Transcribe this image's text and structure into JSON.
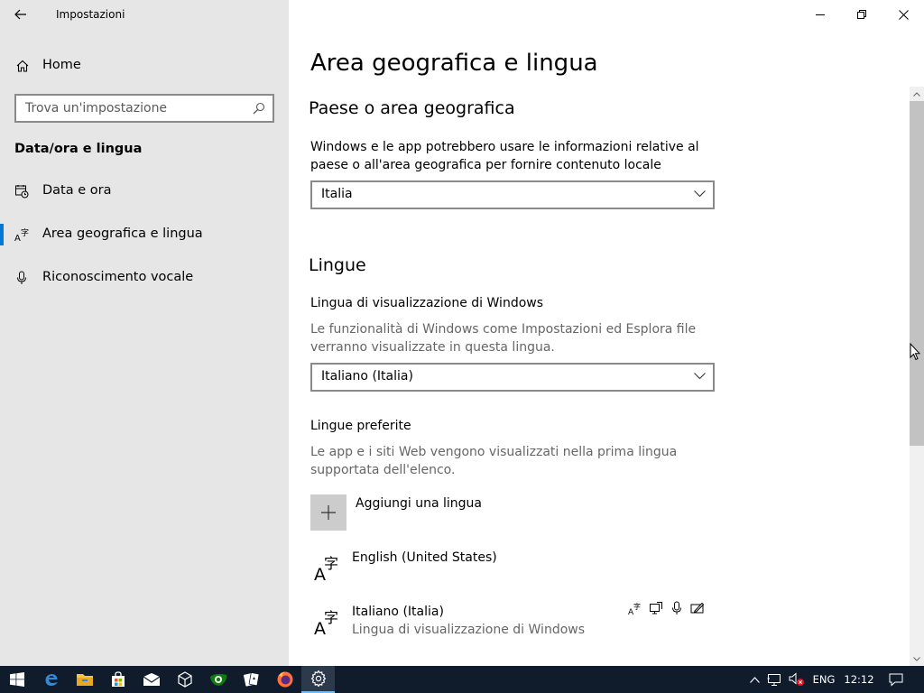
{
  "window": {
    "app_title": "Impostazioni"
  },
  "sidebar": {
    "home_label": "Home",
    "search_placeholder": "Trova un'impostazione",
    "section_title": "Data/ora e lingua",
    "items": [
      {
        "label": "Data e ora",
        "icon": "calendar-clock-icon",
        "active": false
      },
      {
        "label": "Area geografica e lingua",
        "icon": "language-icon",
        "active": true
      },
      {
        "label": "Riconoscimento vocale",
        "icon": "microphone-icon",
        "active": false
      }
    ]
  },
  "main": {
    "title": "Area geografica e lingua",
    "region": {
      "heading": "Paese o area geografica",
      "description": "Windows e le app potrebbero usare le informazioni relative al paese o all'area geografica per fornire contenuto locale",
      "selected": "Italia"
    },
    "languages": {
      "heading": "Lingue",
      "display_label": "Lingua di visualizzazione di Windows",
      "display_description": "Le funzionalità di Windows come Impostazioni ed Esplora file verranno visualizzate in questa lingua.",
      "display_selected": "Italiano (Italia)",
      "preferred_label": "Lingue preferite",
      "preferred_description": "Le app e i siti Web vengono visualizzati nella prima lingua supportata dell'elenco.",
      "add_label": "Aggiungi una lingua",
      "list": [
        {
          "name": "English (United States)",
          "subtitle": ""
        },
        {
          "name": "Italiano (Italia)",
          "subtitle": "Lingua di visualizzazione di Windows"
        }
      ],
      "feature_icons": [
        "language-pack-icon",
        "display-icon",
        "speech-icon",
        "handwriting-icon"
      ]
    }
  },
  "taskbar": {
    "apps": [
      "start-icon",
      "edge-icon",
      "file-explorer-icon",
      "store-icon",
      "mail-icon",
      "3d-viewer-icon",
      "xbox-icon",
      "solitaire-icon",
      "firefox-icon",
      "settings-icon"
    ],
    "active_app": "settings-icon",
    "language": "ENG",
    "time": "12:12"
  },
  "colors": {
    "accent": "#0078d7",
    "sidebar_bg": "#e6e6e6",
    "taskbar_bg": "#101c2c"
  }
}
